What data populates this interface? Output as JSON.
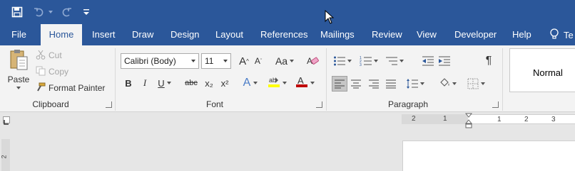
{
  "qat": {
    "save": "save-icon",
    "undo": "undo-icon",
    "redo": "redo-icon",
    "customize": "customize-qat-icon"
  },
  "tabs": [
    "File",
    "Home",
    "Insert",
    "Draw",
    "Design",
    "Layout",
    "References",
    "Mailings",
    "Review",
    "View",
    "Developer",
    "Help"
  ],
  "tell_me": "Te",
  "clipboard": {
    "paste": "Paste",
    "cut": "Cut",
    "copy": "Copy",
    "format_painter": "Format Painter",
    "label": "Clipboard"
  },
  "font": {
    "family": "Calibri (Body)",
    "size": "11",
    "change_case": "Aa",
    "bold": "B",
    "italic": "I",
    "underline": "U",
    "strike": "abc",
    "subscript": "x₂",
    "superscript": "x²",
    "label": "Font",
    "highlight_color": "#ffff00",
    "font_color": "#c00000"
  },
  "paragraph": {
    "label": "Paragraph",
    "pilcrow": "¶"
  },
  "styles": {
    "normal": "Normal"
  },
  "ruler": {
    "h_numbers": [
      "2",
      "1",
      "1",
      "2",
      "3"
    ],
    "v_number": "2"
  },
  "colors": {
    "brand": "#2b579a",
    "ribbon": "#f3f3f3"
  }
}
